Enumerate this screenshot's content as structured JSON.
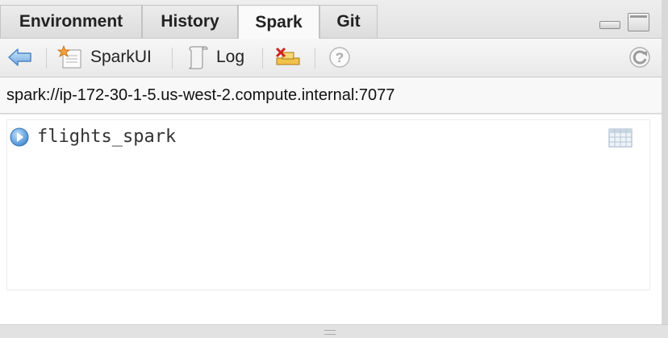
{
  "tabs": [
    {
      "label": "Environment"
    },
    {
      "label": "History"
    },
    {
      "label": "Spark"
    },
    {
      "label": "Git"
    }
  ],
  "toolbar": {
    "sparkui_label": "SparkUI",
    "log_label": "Log"
  },
  "connection": {
    "address": "spark://ip-172-30-1-5.us-west-2.compute.internal:7077"
  },
  "tables": [
    {
      "name": "flights_spark"
    }
  ],
  "icons": {
    "back": "back-arrow-icon",
    "sparkui": "spark-ui-icon",
    "log": "log-icon",
    "disconnect": "disconnect-icon",
    "help": "help-icon",
    "refresh": "refresh-icon",
    "expand": "expand-icon",
    "table": "table-grid-icon"
  }
}
